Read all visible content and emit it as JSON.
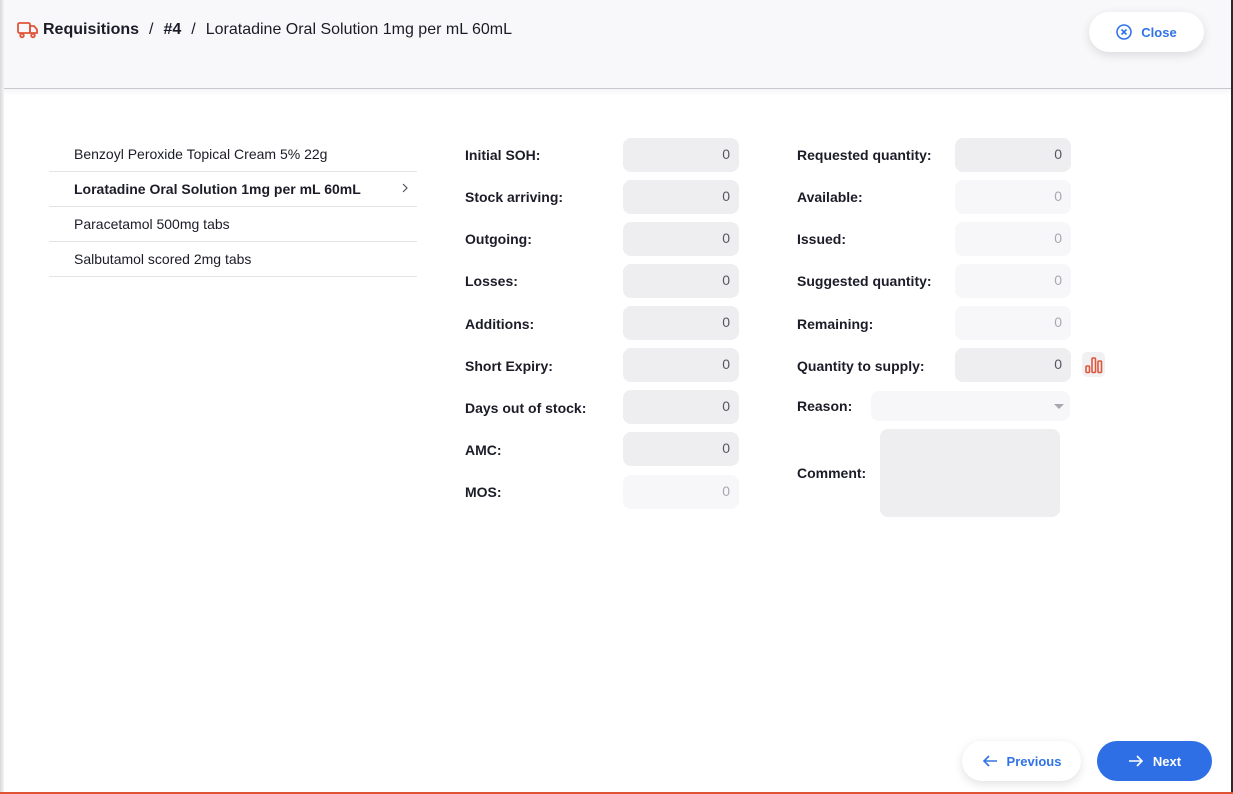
{
  "header": {
    "breadcrumb": {
      "root": "Requisitions",
      "separator": "/",
      "number": "#4",
      "current": "Loratadine Oral Solution 1mg per mL 60mL"
    },
    "close_label": "Close",
    "icon": "truck-icon"
  },
  "items": [
    {
      "label": "Benzoyl Peroxide Topical Cream 5% 22g",
      "selected": false
    },
    {
      "label": "Loratadine Oral Solution 1mg per mL 60mL",
      "selected": true
    },
    {
      "label": "Paracetamol 500mg tabs",
      "selected": false
    },
    {
      "label": "Salbutamol scored 2mg tabs",
      "selected": false
    }
  ],
  "left_fields": [
    {
      "label": "Initial SOH:",
      "value": "0",
      "disabled": false
    },
    {
      "label": "Stock arriving:",
      "value": "0",
      "disabled": false
    },
    {
      "label": "Outgoing:",
      "value": "0",
      "disabled": false
    },
    {
      "label": "Losses:",
      "value": "0",
      "disabled": false
    },
    {
      "label": "Additions:",
      "value": "0",
      "disabled": false
    },
    {
      "label": "Short Expiry:",
      "value": "0",
      "disabled": false
    },
    {
      "label": "Days out of stock:",
      "value": "0",
      "disabled": false
    },
    {
      "label": "AMC:",
      "value": "0",
      "disabled": false
    },
    {
      "label": "MOS:",
      "value": "0",
      "disabled": true
    }
  ],
  "right_fields": [
    {
      "label": "Requested quantity:",
      "value": "0",
      "disabled": false
    },
    {
      "label": "Available:",
      "value": "0",
      "disabled": true
    },
    {
      "label": "Issued:",
      "value": "0",
      "disabled": true
    },
    {
      "label": "Suggested quantity:",
      "value": "0",
      "disabled": true
    },
    {
      "label": "Remaining:",
      "value": "0",
      "disabled": true
    },
    {
      "label": "Quantity to supply:",
      "value": "0",
      "disabled": false
    }
  ],
  "reason": {
    "label": "Reason:",
    "value": ""
  },
  "comment": {
    "label": "Comment:",
    "value": ""
  },
  "footer": {
    "previous_label": "Previous",
    "next_label": "Next"
  },
  "colors": {
    "accent": "#2f6fe6",
    "brand": "#e0553a"
  }
}
